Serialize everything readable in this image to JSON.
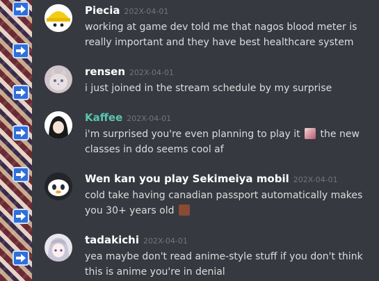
{
  "messages": [
    {
      "author": "Piecia",
      "timestamp": "202X-04-01",
      "text": "working at game dev told me that nagos blood meter is really important and they have best healthcare system",
      "author_color": "#ffffff",
      "avatar": "yellow-hardhat-avatar"
    },
    {
      "author": "rensen",
      "timestamp": "202X-04-01",
      "text": "i just joined in the stream schedule by my surprise",
      "author_color": "#ffffff",
      "avatar": "cat-photo-avatar"
    },
    {
      "author": "Kaffee",
      "timestamp": "202X-04-01",
      "text_before": "i'm surprised you're even planning to play it",
      "text_after": "the new classes in ddo seems cool af",
      "author_color": "#58c5b2",
      "avatar": "dark-hair-avatar",
      "emoji": "anime-face-emoji"
    },
    {
      "author": "Wen kan you play Sekimeiya mobil",
      "timestamp": "202X-04-01",
      "text": "cold take having canadian passport automatically makes you 30+ years old",
      "author_color": "#ffffff",
      "avatar": "penguin-avatar",
      "emoji": "brown-emote-emoji"
    },
    {
      "author": "tadakichi",
      "timestamp": "202X-04-01",
      "text": "yea maybe don't read anime-style stuff if you don't think this is anime you're in denial",
      "author_color": "#ffffff",
      "avatar": "silver-hair-avatar"
    }
  ]
}
